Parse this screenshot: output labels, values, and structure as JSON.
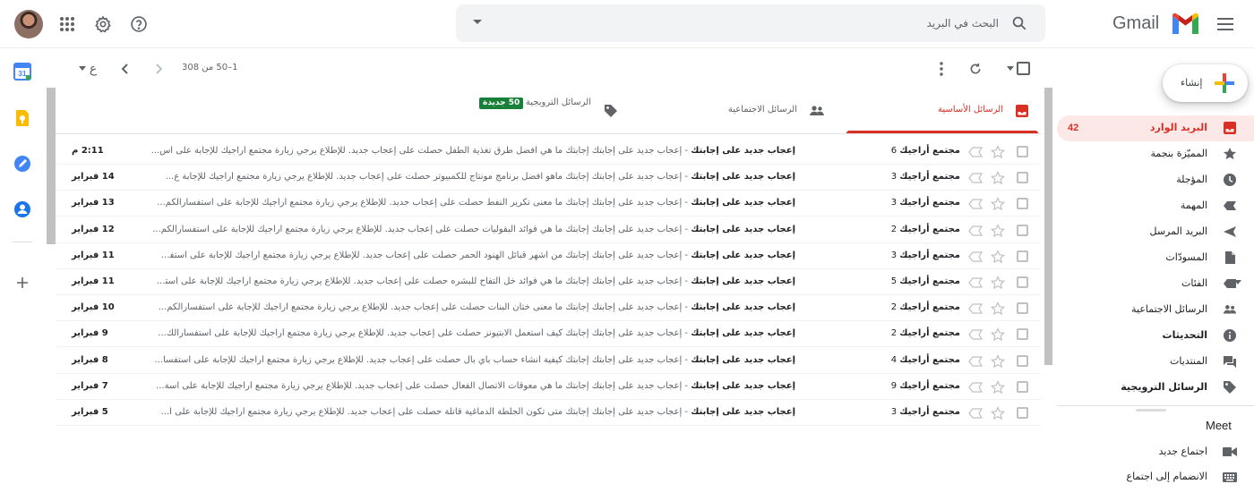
{
  "header": {
    "logo_text": "Gmail",
    "search_placeholder": "البحث في البريد"
  },
  "compose": {
    "label": "إنشاء"
  },
  "sidebar": {
    "items": [
      {
        "label": "البريد الوارد",
        "count": "42",
        "icon": "inbox-icon",
        "active": true
      },
      {
        "label": "المميّزة بنجمة",
        "icon": "star-icon"
      },
      {
        "label": "المؤجلة",
        "icon": "clock-icon"
      },
      {
        "label": "المهمة",
        "icon": "important-icon"
      },
      {
        "label": "البريد المرسل",
        "icon": "send-icon"
      },
      {
        "label": "المسودّات",
        "icon": "draft-icon"
      },
      {
        "label": "الفئات",
        "icon": "label-icon"
      },
      {
        "label": "الرسائل الاجتماعية",
        "icon": "people-icon"
      },
      {
        "label": "التحديثات",
        "icon": "info-icon"
      },
      {
        "label": "المنتديات",
        "icon": "forum-icon"
      },
      {
        "label": "الرسائل الترويجية",
        "icon": "tag-icon"
      }
    ]
  },
  "meet": {
    "title": "Meet",
    "items": [
      {
        "label": "اجتماع جديد",
        "icon": "video-icon"
      },
      {
        "label": "الانضمام إلى اجتماع",
        "icon": "keyboard-icon"
      }
    ]
  },
  "toolbar": {
    "pagination": "1–50 من 308",
    "input_tool": "ع"
  },
  "tabs": [
    {
      "label": "الرسائل الأساسية",
      "icon": "inbox-icon",
      "active": true
    },
    {
      "label": "الرسائل الاجتماعية",
      "icon": "people-icon"
    },
    {
      "label": "الرسائل الترويجية",
      "icon": "tag-icon",
      "badge": "50 جديدة"
    }
  ],
  "emails": [
    {
      "sender": "مجتمع أراجيك",
      "count": "6",
      "subject": "إعجاب جديد على إجابتك",
      "snippet": "إعجاب جديد على إجابتك إجابتك ما هي افضل طرق تغذية الطفل حصلت على إعجاب جديد. للإطلاع يرجي زيارة مجتمع أراجيك للإجابة على اس...",
      "date": "2:11 م"
    },
    {
      "sender": "مجتمع أراجيك",
      "count": "3",
      "subject": "إعجاب جديد على إجابتك",
      "snippet": "إعجاب جديد على إجابتك إجابتك ماهو افضل برنامج مونتاج للكمبيوتر حصلت على إعجاب جديد. للإطلاع يرجي زيارة مجتمع أراجيك للإجابة ع...",
      "date": "14 فبراير"
    },
    {
      "sender": "مجتمع أراجيك",
      "count": "3",
      "subject": "إعجاب جديد على إجابتك",
      "snippet": "إعجاب جديد على إجابتك إجابتك ما معنى تكرير النفط حصلت على إعجاب جديد. للإطلاع يرجي زيارة مجتمع أراجيك للإجابة على استفسارالكم...",
      "date": "13 فبراير"
    },
    {
      "sender": "مجتمع أراجيك",
      "count": "2",
      "subject": "إعجاب جديد على إجابتك",
      "snippet": "إعجاب جديد على إجابتك إجابتك ما هي فوائد البقوليات حصلت على إعجاب جديد. للإطلاع يرجي زيارة مجتمع أراجيك للإجابة على استفسارالكم...",
      "date": "12 فبراير"
    },
    {
      "sender": "مجتمع أراجيك",
      "count": "3",
      "subject": "إعجاب جديد على إجابتك",
      "snippet": "إعجاب جديد على إجابتك إجابتك من اشهر قبائل الهنود الحمر حصلت على إعجاب جديد. للإطلاع يرجي زيارة مجتمع أراجيك للإجابة على استفس...",
      "date": "11 فبراير"
    },
    {
      "sender": "مجتمع أراجيك",
      "count": "5",
      "subject": "إعجاب جديد على إجابتك",
      "snippet": "إعجاب جديد على إجابتك إجابتك ما هي فوائد خل التفاح للبشره حصلت على إعجاب جديد. للإطلاع يرجي زيارة مجتمع أراجيك للإجابة على استف...",
      "date": "11 فبراير"
    },
    {
      "sender": "مجتمع أراجيك",
      "count": "2",
      "subject": "إعجاب جديد على إجابتك",
      "snippet": "إعجاب جديد على إجابتك إجابتك ما معنى ختان البنات حصلت على إعجاب جديد. للإطلاع يرجي زيارة مجتمع أراجيك للإجابة على استفسارالكم...",
      "date": "10 فبراير"
    },
    {
      "sender": "مجتمع أراجيك",
      "count": "2",
      "subject": "إعجاب جديد على إجابتك",
      "snippet": "إعجاب جديد على إجابتك إجابتك كيف أستعمل الابتيونز حصلت على إعجاب جديد. للإطلاع يرجي زيارة مجتمع أراجيك للإجابة على استفسارالك...",
      "date": "9 فبراير"
    },
    {
      "sender": "مجتمع أراجيك",
      "count": "4",
      "subject": "إعجاب جديد على إجابتك",
      "snippet": "إعجاب جديد على إجابتك إجابتك كيفية انشاء حساب باي بال حصلت على إعجاب جديد. للإطلاع يرجي زيارة مجتمع أراجيك للإجابة على استفسا...",
      "date": "8 فبراير"
    },
    {
      "sender": "مجتمع أراجيك",
      "count": "9",
      "subject": "إعجاب جديد على إجابتك",
      "snippet": "إعجاب جديد على إجابتك إجابتك ما هي معوقات الاتصال الفعال حصلت على إعجاب جديد. للإطلاع يرجي زيارة مجتمع أراجيك للإجابة على اسة...",
      "date": "7 فبراير"
    },
    {
      "sender": "مجتمع أراجيك",
      "count": "3",
      "subject": "إعجاب جديد على إجابتك",
      "snippet": "إعجاب جديد على إجابتك إجابتك متى تكون الجلطة الدماغية قاتلة حصلت على إعجاب جديد. للإطلاع يرجي زيارة مجتمع أراجيك للإجابة على ا...",
      "date": "5 فبراير"
    }
  ]
}
